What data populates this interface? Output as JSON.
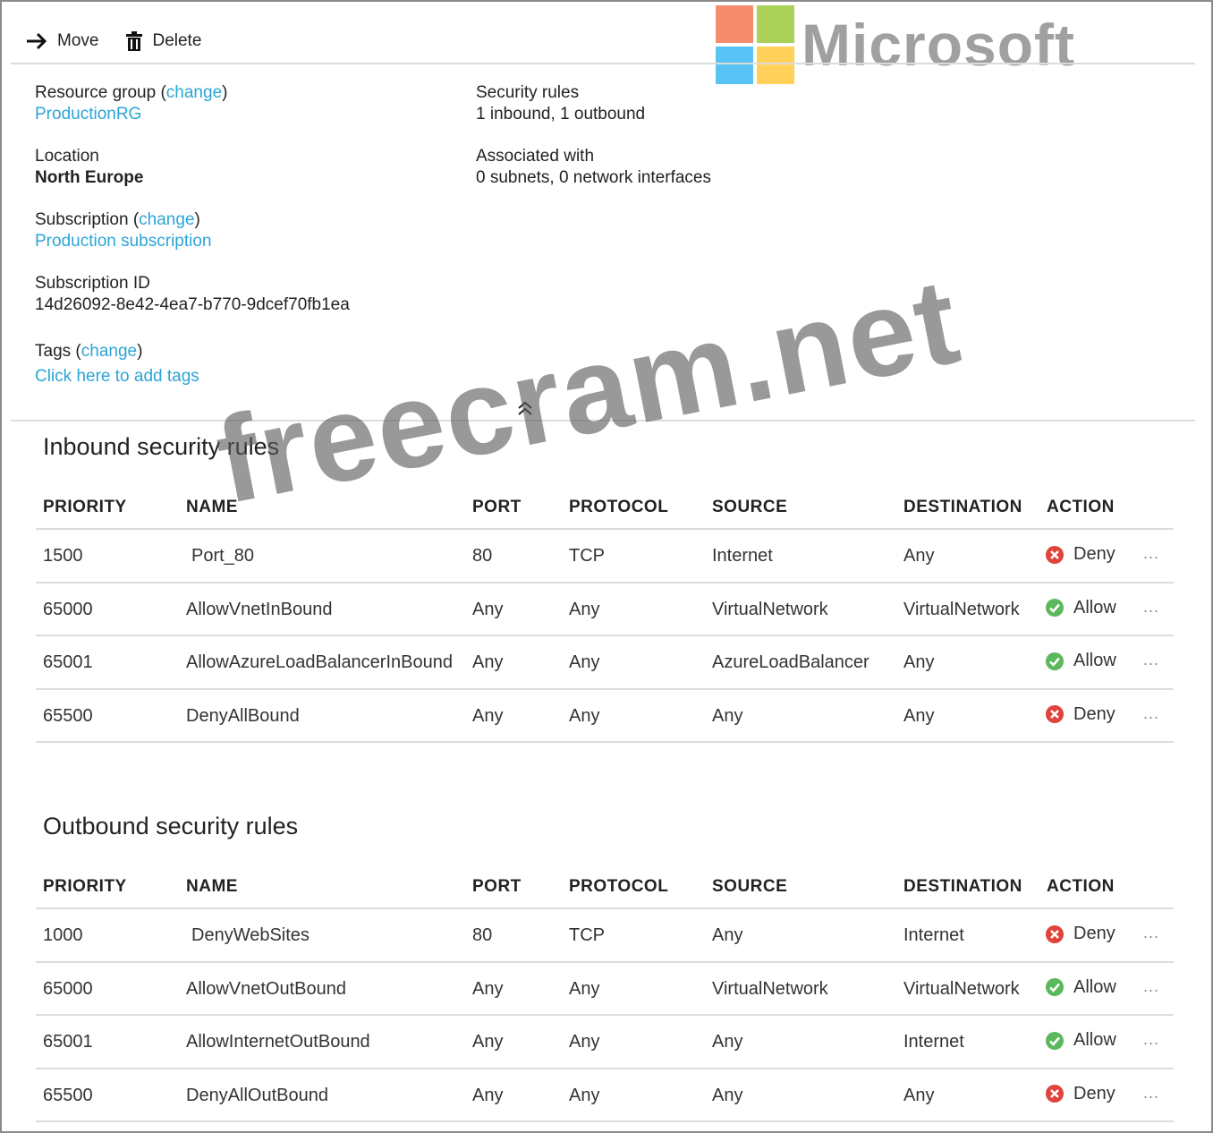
{
  "toolbar": {
    "move_label": "Move",
    "delete_label": "Delete"
  },
  "logo": {
    "text": "Microsoft",
    "colors": [
      "#f25022",
      "#7fba00",
      "#00a4ef",
      "#ffb900"
    ]
  },
  "essentials": {
    "resource_group": {
      "label": "Resource group (",
      "change": "change",
      "close": ")",
      "value": "ProductionRG"
    },
    "location": {
      "label": "Location",
      "value": "North Europe"
    },
    "subscription": {
      "label": "Subscription (",
      "change": "change",
      "close": ")",
      "value": "Production subscription"
    },
    "subscription_id": {
      "label": "Subscription ID",
      "value": "14d26092-8e42-4ea7-b770-9dcef70fb1ea"
    },
    "tags": {
      "label": "Tags (",
      "change": "change",
      "close": ")",
      "value": "Click here to add tags"
    },
    "security_rules": {
      "label": "Security rules",
      "value": "1 inbound, 1 outbound"
    },
    "associated_with": {
      "label": "Associated with",
      "value": "0 subnets, 0 network interfaces"
    }
  },
  "columns": [
    "PRIORITY",
    "NAME",
    "PORT",
    "PROTOCOL",
    "SOURCE",
    "DESTINATION",
    "ACTION"
  ],
  "inbound": {
    "title": "Inbound security rules",
    "rows": [
      {
        "priority": "1500",
        "name": "Port_80",
        "port": "80",
        "protocol": "TCP",
        "source": "Internet",
        "destination": "Any",
        "action": "Deny"
      },
      {
        "priority": "65000",
        "name": "AllowVnetInBound",
        "port": "Any",
        "protocol": "Any",
        "source": "VirtualNetwork",
        "destination": "VirtualNetwork",
        "action": "Allow"
      },
      {
        "priority": "65001",
        "name": "AllowAzureLoadBalancerInBound",
        "port": "Any",
        "protocol": "Any",
        "source": "AzureLoadBalancer",
        "destination": "Any",
        "action": "Allow"
      },
      {
        "priority": "65500",
        "name": "DenyAllBound",
        "port": "Any",
        "protocol": "Any",
        "source": "Any",
        "destination": "Any",
        "action": "Deny"
      }
    ]
  },
  "outbound": {
    "title": "Outbound security rules",
    "rows": [
      {
        "priority": "1000",
        "name": "DenyWebSites",
        "port": "80",
        "protocol": "TCP",
        "source": "Any",
        "destination": "Internet",
        "action": "Deny"
      },
      {
        "priority": "65000",
        "name": "AllowVnetOutBound",
        "port": "Any",
        "protocol": "Any",
        "source": "VirtualNetwork",
        "destination": "VirtualNetwork",
        "action": "Allow"
      },
      {
        "priority": "65001",
        "name": "AllowInternetOutBound",
        "port": "Any",
        "protocol": "Any",
        "source": "Any",
        "destination": "Internet",
        "action": "Allow"
      },
      {
        "priority": "65500",
        "name": "DenyAllOutBound",
        "port": "Any",
        "protocol": "Any",
        "source": "Any",
        "destination": "Any",
        "action": "Deny"
      }
    ]
  },
  "more_label": "...",
  "status_colors": {
    "allow": "#5cb85c",
    "deny": "#e0433b",
    "link": "#2ba5d6"
  },
  "watermark": "freecram.net"
}
